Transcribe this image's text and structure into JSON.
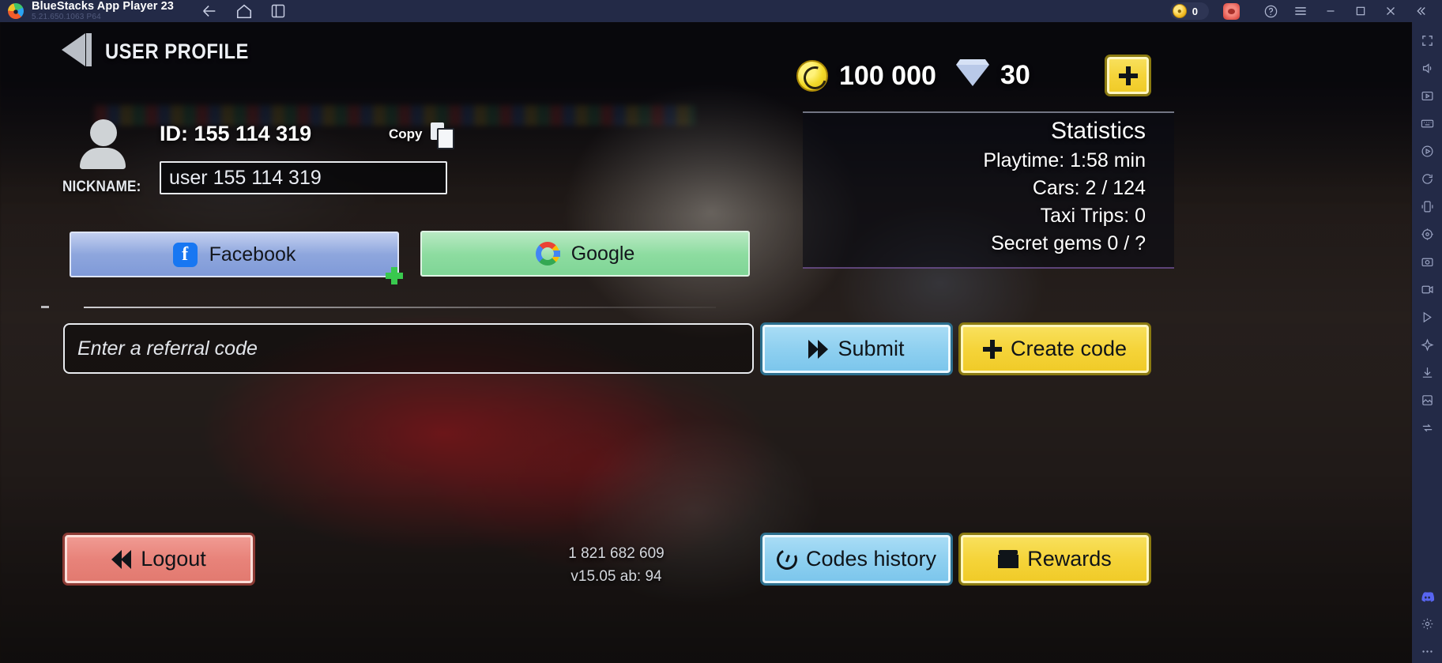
{
  "titlebar": {
    "app_name": "BlueStacks App Player 23",
    "version": "5.21.650.1063  P64",
    "nav": [
      {
        "name": "back-icon",
        "glyph": "←"
      },
      {
        "name": "home-icon",
        "glyph": "⌂"
      },
      {
        "name": "multi-instance-icon",
        "glyph": "◱"
      }
    ],
    "coin_count": "0",
    "controls": [
      {
        "name": "help-icon",
        "glyph": "?"
      },
      {
        "name": "menu-icon",
        "glyph": "☰"
      },
      {
        "name": "minimize-icon",
        "glyph": "─"
      },
      {
        "name": "maximize-icon",
        "glyph": "□"
      },
      {
        "name": "close-icon",
        "glyph": "✕"
      },
      {
        "name": "collapse-icon",
        "glyph": "«"
      }
    ]
  },
  "sidebar": {
    "items": [
      {
        "name": "fullscreen-icon",
        "glyph": "⛶"
      },
      {
        "name": "volume-icon",
        "glyph": "ὐA"
      },
      {
        "name": "media-icon",
        "glyph": "▶"
      },
      {
        "name": "keymapping-icon",
        "glyph": "⌨"
      },
      {
        "name": "play-icon",
        "glyph": "▷"
      },
      {
        "name": "rotate-icon",
        "glyph": "↻"
      },
      {
        "name": "shake-icon",
        "glyph": "⬌"
      },
      {
        "name": "location-icon",
        "glyph": "◎"
      },
      {
        "name": "screenshot-icon",
        "glyph": "▣"
      },
      {
        "name": "record-icon",
        "glyph": "⬚"
      },
      {
        "name": "macro-icon",
        "glyph": "△"
      },
      {
        "name": "eco-mode-icon",
        "glyph": "✦"
      },
      {
        "name": "install-apk-icon",
        "glyph": "⤓"
      },
      {
        "name": "trim-icon",
        "glyph": "✂"
      },
      {
        "name": "sync-icon",
        "glyph": "⇄"
      },
      {
        "name": "discord-icon",
        "glyph": "◉"
      },
      {
        "name": "settings-icon",
        "glyph": "⚙"
      },
      {
        "name": "more-icon",
        "glyph": "⋯"
      }
    ]
  },
  "game": {
    "page_title": "USER PROFILE",
    "currency": {
      "coins": "100 000",
      "gems": "30",
      "add_label": "+"
    },
    "profile": {
      "id_label": "ID: 155 114 319",
      "copy_label": "Copy",
      "nickname_label": "NICKNAME:",
      "nickname_value": "user 155 114 319"
    },
    "social": {
      "facebook_label": "Facebook",
      "google_label": "Google"
    },
    "referral": {
      "placeholder": "Enter a referral code",
      "value": "",
      "submit_label": "Submit",
      "create_code_label": "Create code"
    },
    "statistics": {
      "title": "Statistics",
      "rows": [
        "Playtime: 1:58 min",
        "Cars: 2 / 124",
        "Taxi Trips: 0",
        "Secret gems 0 / ?"
      ]
    },
    "footer": {
      "logout_label": "Logout",
      "codes_history_label": "Codes history",
      "rewards_label": "Rewards",
      "build_number": "1 821 682 609",
      "build_version": "v15.05 ab: 94"
    }
  }
}
